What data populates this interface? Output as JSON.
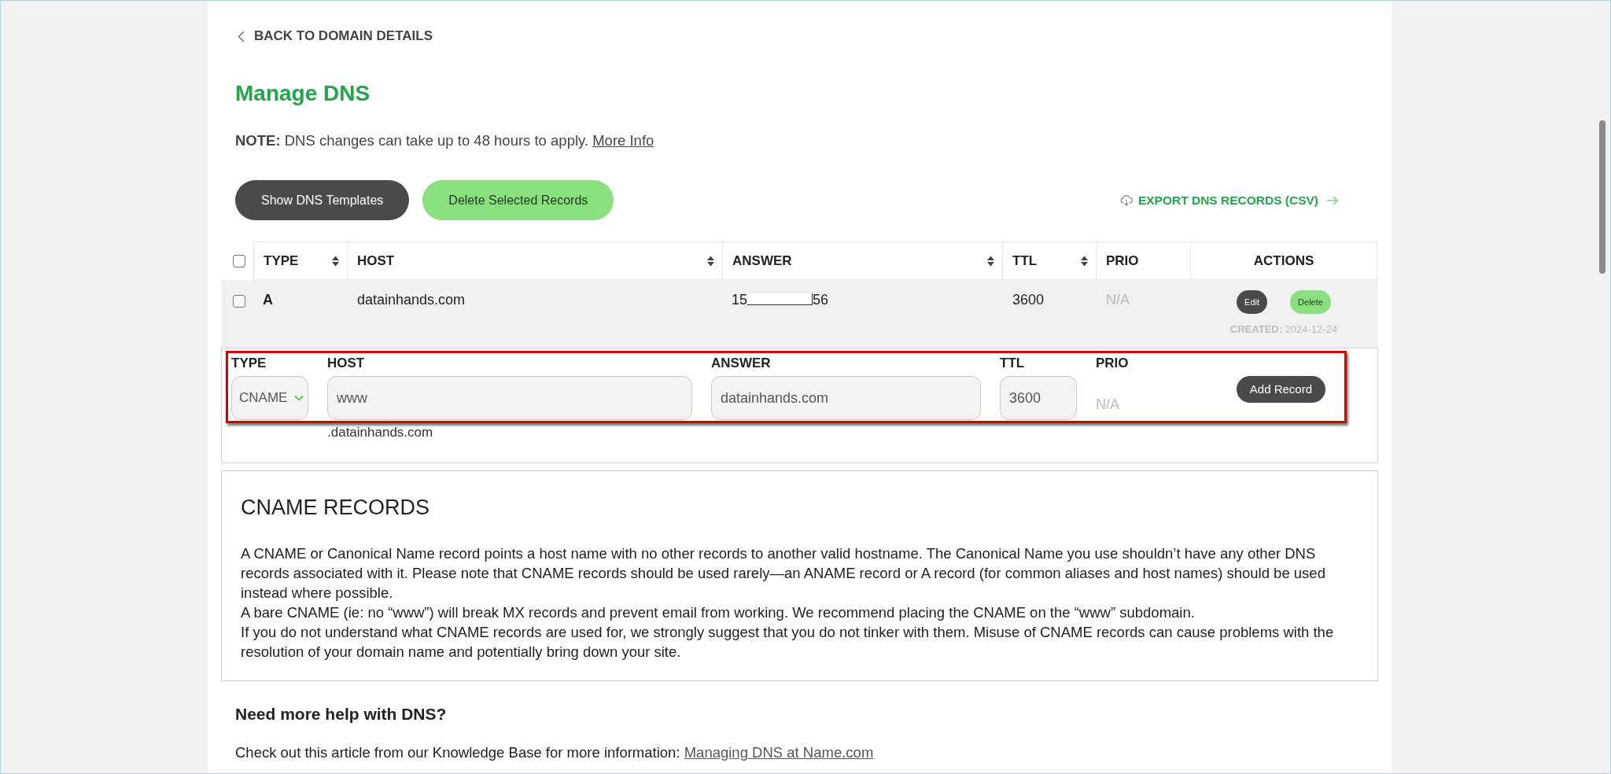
{
  "back_link": {
    "label": "BACK TO DOMAIN DETAILS"
  },
  "title": "Manage DNS",
  "note": {
    "text": "**NOTE:** DNS changes can take up to 48 hours to apply.",
    "link": "More Info"
  },
  "buttons": [
    {
      "label": "Show DNS Templates",
      "kind": "dark"
    },
    {
      "label": "Delete Selected Records",
      "kind": "green"
    }
  ],
  "export_link": {
    "label": "EXPORT DNS RECORDS (CSV)"
  },
  "table": {
    "select_all": {
      "checked": false
    },
    "columns": [
      {
        "label": "TYPE",
        "sortable": true
      },
      {
        "label": "HOST",
        "sortable": true
      },
      {
        "label": "ANSWER",
        "sortable": true
      },
      {
        "label": "TTL",
        "sortable": true
      },
      {
        "label": "PRIO",
        "sortable": false
      },
      {
        "label": "ACTIONS",
        "sortable": false
      }
    ],
    "rows": [
      {
        "checked": false,
        "type": "A",
        "host": "datainhands.com",
        "answer": {
          "start": "15",
          "end": "56",
          "redacted": true
        },
        "ttl": "3600",
        "prio": "N/A",
        "actions": [
          {
            "label": "Edit",
            "kind": "dark"
          },
          {
            "label": "Delete",
            "kind": "green"
          }
        ],
        "created": "**CREATED:** 2024-12-24"
      }
    ]
  },
  "new_record": {
    "highlighted": true,
    "fields": [
      {
        "label": "TYPE",
        "kind": "select",
        "value": "CNAME"
      },
      {
        "label": "HOST",
        "kind": "input",
        "value": "www",
        "suffix": ".datainhands.com"
      },
      {
        "label": "ANSWER",
        "kind": "input",
        "value": "datainhands.com"
      },
      {
        "label": "TTL",
        "kind": "input",
        "value": "3600"
      },
      {
        "label": "PRIO",
        "kind": "text",
        "value": "N/A"
      }
    ],
    "button": {
      "label": "Add Record"
    }
  },
  "info": {
    "title": "CNAME RECORDS",
    "paragraphs": [
      "A CNAME or Canonical Name record points a host name with no other records to another valid hostname. The Canonical Name you use shouldn’t have any other DNS records associated with it. Please note that CNAME records should be used rarely—an ANAME record or A record (for common aliases and host names) should be used instead where possible.",
      "A bare CNAME (ie: no “www”) will break MX records and prevent email from working. We recommend placing the CNAME on the “www” subdomain.",
      "If you do not understand what CNAME records are used for, we strongly suggest that you do not tinker with them. Misuse of CNAME records can cause problems with the resolution of your domain name and potentially bring down your site."
    ]
  },
  "help": {
    "title": "Need more help with DNS?",
    "text": "Check out this article from our Knowledge Base for more information:",
    "link": "Managing DNS at Name.com"
  }
}
